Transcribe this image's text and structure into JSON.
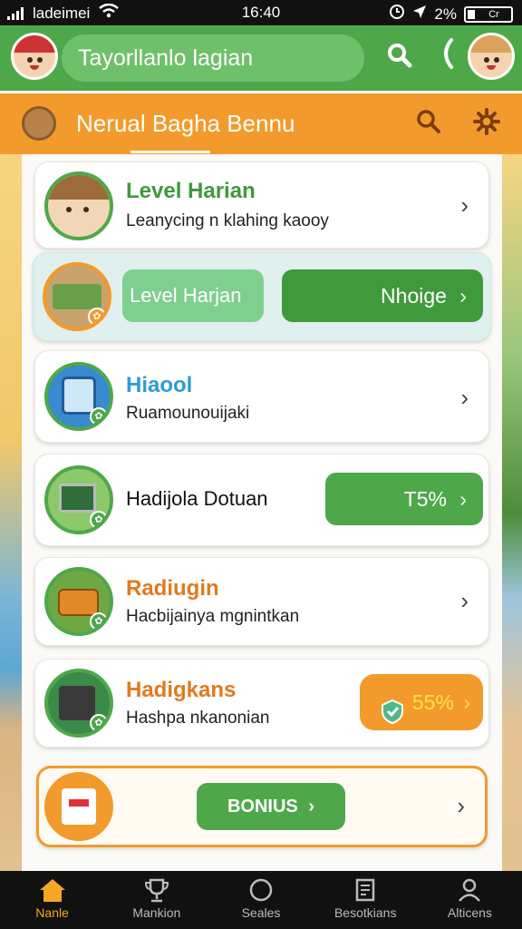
{
  "status_bar": {
    "carrier": "ladeimei",
    "time": "16:40",
    "battery_text": "2%",
    "battery_label": "Cr"
  },
  "header": {
    "search_text": "Tayorllanlo lagian"
  },
  "sub_header": {
    "title": "Nerual Bagha Bennu"
  },
  "cards": [
    {
      "title": "Level Harian",
      "subtitle": "Leanycing n klahing kaooy"
    },
    {
      "title_pill": "Level Harjan",
      "action_pill": "Nhoige"
    },
    {
      "title": "Hiaool",
      "subtitle": "Ruamounouijaki"
    },
    {
      "title": "Hadijola Dotuan",
      "percent_pill": "T5%"
    },
    {
      "title": "Radiugin",
      "subtitle": "Hacbijainya mgnintkan"
    },
    {
      "title": "Hadigkans",
      "subtitle": "Hashpa nkanonian",
      "percent_pill": "55%"
    },
    {
      "bonus_label": "BONIUS"
    }
  ],
  "bottom_nav": [
    {
      "label": "Nanle",
      "icon": "home-icon"
    },
    {
      "label": "Mankion",
      "icon": "trophy-icon"
    },
    {
      "label": "Seales",
      "icon": "circle-icon"
    },
    {
      "label": "Besotkians",
      "icon": "document-icon"
    },
    {
      "label": "Alticens",
      "icon": "person-icon"
    }
  ],
  "colors": {
    "header_green": "#4ea84a",
    "sub_header_orange": "#f39a2c",
    "accent_green": "#4ea84a",
    "accent_orange": "#f39a2c",
    "nav_active": "#f5a623"
  }
}
